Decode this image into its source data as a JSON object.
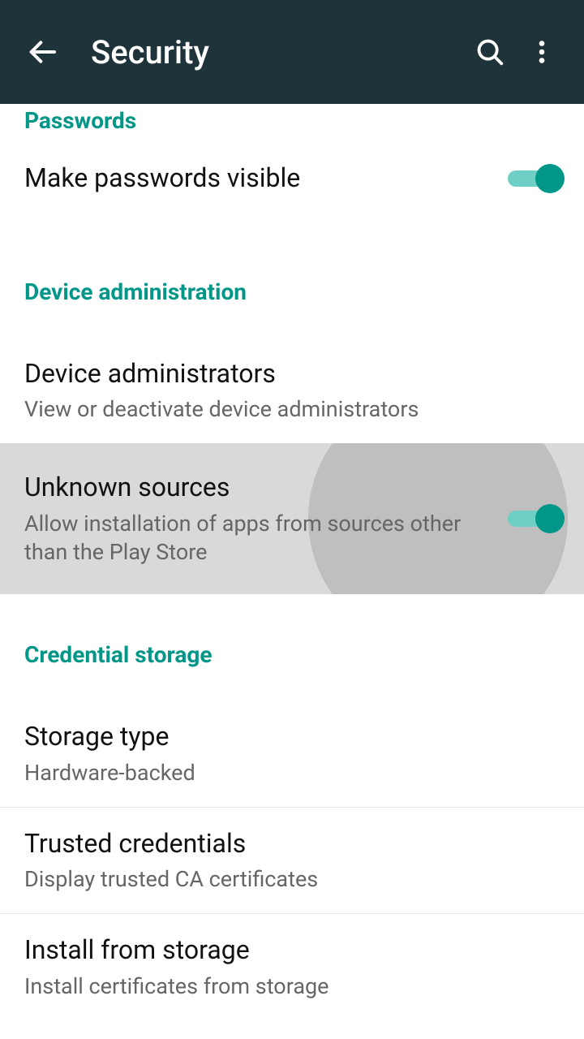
{
  "appbar": {
    "title": "Security"
  },
  "sections": {
    "passwords": {
      "header": "Passwords",
      "make_visible": {
        "title": "Make passwords visible",
        "on": true
      }
    },
    "device_admin": {
      "header": "Device administration",
      "administrators": {
        "title": "Device administrators",
        "sub": "View or deactivate device administrators"
      },
      "unknown_sources": {
        "title": "Unknown sources",
        "sub": "Allow installation of apps from sources other than the Play Store",
        "on": true
      }
    },
    "credential_storage": {
      "header": "Credential storage",
      "storage_type": {
        "title": "Storage type",
        "sub": "Hardware-backed"
      },
      "trusted": {
        "title": "Trusted credentials",
        "sub": "Display trusted CA certificates"
      },
      "install": {
        "title": "Install from storage",
        "sub": "Install certificates from storage"
      }
    }
  }
}
